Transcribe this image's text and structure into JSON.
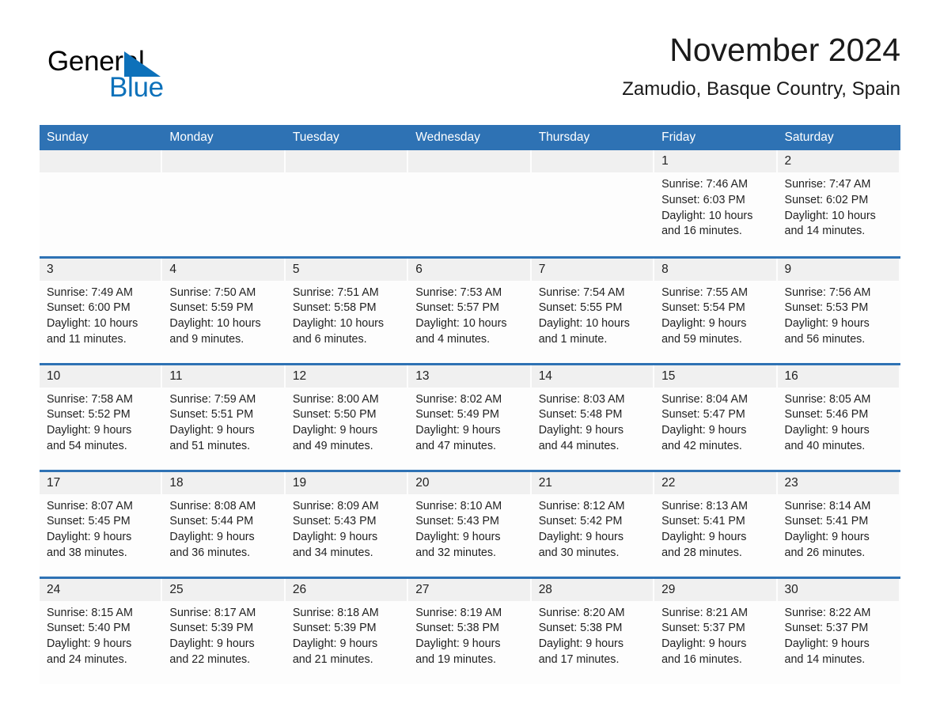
{
  "brand": {
    "name_part1": "General",
    "name_part2": "Blue",
    "flag_icon": "triangle-flag-icon",
    "colors": {
      "blue": "#0d71ba",
      "black": "#000000"
    }
  },
  "header": {
    "month_title": "November 2024",
    "location": "Zamudio, Basque Country, Spain"
  },
  "theme": {
    "header_blue": "#2e72b4",
    "daynum_bg": "#f0f0f0",
    "cell_bg": "#fdfdfd",
    "text": "#222222"
  },
  "weekday_headers": [
    "Sunday",
    "Monday",
    "Tuesday",
    "Wednesday",
    "Thursday",
    "Friday",
    "Saturday"
  ],
  "weeks": [
    [
      {
        "day": "",
        "empty": true,
        "lines": []
      },
      {
        "day": "",
        "empty": true,
        "lines": []
      },
      {
        "day": "",
        "empty": true,
        "lines": []
      },
      {
        "day": "",
        "empty": true,
        "lines": []
      },
      {
        "day": "",
        "empty": true,
        "lines": []
      },
      {
        "day": "1",
        "empty": false,
        "lines": [
          "Sunrise: 7:46 AM",
          "Sunset: 6:03 PM",
          "Daylight: 10 hours",
          "and 16 minutes."
        ]
      },
      {
        "day": "2",
        "empty": false,
        "lines": [
          "Sunrise: 7:47 AM",
          "Sunset: 6:02 PM",
          "Daylight: 10 hours",
          "and 14 minutes."
        ]
      }
    ],
    [
      {
        "day": "3",
        "empty": false,
        "lines": [
          "Sunrise: 7:49 AM",
          "Sunset: 6:00 PM",
          "Daylight: 10 hours",
          "and 11 minutes."
        ]
      },
      {
        "day": "4",
        "empty": false,
        "lines": [
          "Sunrise: 7:50 AM",
          "Sunset: 5:59 PM",
          "Daylight: 10 hours",
          "and 9 minutes."
        ]
      },
      {
        "day": "5",
        "empty": false,
        "lines": [
          "Sunrise: 7:51 AM",
          "Sunset: 5:58 PM",
          "Daylight: 10 hours",
          "and 6 minutes."
        ]
      },
      {
        "day": "6",
        "empty": false,
        "lines": [
          "Sunrise: 7:53 AM",
          "Sunset: 5:57 PM",
          "Daylight: 10 hours",
          "and 4 minutes."
        ]
      },
      {
        "day": "7",
        "empty": false,
        "lines": [
          "Sunrise: 7:54 AM",
          "Sunset: 5:55 PM",
          "Daylight: 10 hours",
          "and 1 minute."
        ]
      },
      {
        "day": "8",
        "empty": false,
        "lines": [
          "Sunrise: 7:55 AM",
          "Sunset: 5:54 PM",
          "Daylight: 9 hours",
          "and 59 minutes."
        ]
      },
      {
        "day": "9",
        "empty": false,
        "lines": [
          "Sunrise: 7:56 AM",
          "Sunset: 5:53 PM",
          "Daylight: 9 hours",
          "and 56 minutes."
        ]
      }
    ],
    [
      {
        "day": "10",
        "empty": false,
        "lines": [
          "Sunrise: 7:58 AM",
          "Sunset: 5:52 PM",
          "Daylight: 9 hours",
          "and 54 minutes."
        ]
      },
      {
        "day": "11",
        "empty": false,
        "lines": [
          "Sunrise: 7:59 AM",
          "Sunset: 5:51 PM",
          "Daylight: 9 hours",
          "and 51 minutes."
        ]
      },
      {
        "day": "12",
        "empty": false,
        "lines": [
          "Sunrise: 8:00 AM",
          "Sunset: 5:50 PM",
          "Daylight: 9 hours",
          "and 49 minutes."
        ]
      },
      {
        "day": "13",
        "empty": false,
        "lines": [
          "Sunrise: 8:02 AM",
          "Sunset: 5:49 PM",
          "Daylight: 9 hours",
          "and 47 minutes."
        ]
      },
      {
        "day": "14",
        "empty": false,
        "lines": [
          "Sunrise: 8:03 AM",
          "Sunset: 5:48 PM",
          "Daylight: 9 hours",
          "and 44 minutes."
        ]
      },
      {
        "day": "15",
        "empty": false,
        "lines": [
          "Sunrise: 8:04 AM",
          "Sunset: 5:47 PM",
          "Daylight: 9 hours",
          "and 42 minutes."
        ]
      },
      {
        "day": "16",
        "empty": false,
        "lines": [
          "Sunrise: 8:05 AM",
          "Sunset: 5:46 PM",
          "Daylight: 9 hours",
          "and 40 minutes."
        ]
      }
    ],
    [
      {
        "day": "17",
        "empty": false,
        "lines": [
          "Sunrise: 8:07 AM",
          "Sunset: 5:45 PM",
          "Daylight: 9 hours",
          "and 38 minutes."
        ]
      },
      {
        "day": "18",
        "empty": false,
        "lines": [
          "Sunrise: 8:08 AM",
          "Sunset: 5:44 PM",
          "Daylight: 9 hours",
          "and 36 minutes."
        ]
      },
      {
        "day": "19",
        "empty": false,
        "lines": [
          "Sunrise: 8:09 AM",
          "Sunset: 5:43 PM",
          "Daylight: 9 hours",
          "and 34 minutes."
        ]
      },
      {
        "day": "20",
        "empty": false,
        "lines": [
          "Sunrise: 8:10 AM",
          "Sunset: 5:43 PM",
          "Daylight: 9 hours",
          "and 32 minutes."
        ]
      },
      {
        "day": "21",
        "empty": false,
        "lines": [
          "Sunrise: 8:12 AM",
          "Sunset: 5:42 PM",
          "Daylight: 9 hours",
          "and 30 minutes."
        ]
      },
      {
        "day": "22",
        "empty": false,
        "lines": [
          "Sunrise: 8:13 AM",
          "Sunset: 5:41 PM",
          "Daylight: 9 hours",
          "and 28 minutes."
        ]
      },
      {
        "day": "23",
        "empty": false,
        "lines": [
          "Sunrise: 8:14 AM",
          "Sunset: 5:41 PM",
          "Daylight: 9 hours",
          "and 26 minutes."
        ]
      }
    ],
    [
      {
        "day": "24",
        "empty": false,
        "lines": [
          "Sunrise: 8:15 AM",
          "Sunset: 5:40 PM",
          "Daylight: 9 hours",
          "and 24 minutes."
        ]
      },
      {
        "day": "25",
        "empty": false,
        "lines": [
          "Sunrise: 8:17 AM",
          "Sunset: 5:39 PM",
          "Daylight: 9 hours",
          "and 22 minutes."
        ]
      },
      {
        "day": "26",
        "empty": false,
        "lines": [
          "Sunrise: 8:18 AM",
          "Sunset: 5:39 PM",
          "Daylight: 9 hours",
          "and 21 minutes."
        ]
      },
      {
        "day": "27",
        "empty": false,
        "lines": [
          "Sunrise: 8:19 AM",
          "Sunset: 5:38 PM",
          "Daylight: 9 hours",
          "and 19 minutes."
        ]
      },
      {
        "day": "28",
        "empty": false,
        "lines": [
          "Sunrise: 8:20 AM",
          "Sunset: 5:38 PM",
          "Daylight: 9 hours",
          "and 17 minutes."
        ]
      },
      {
        "day": "29",
        "empty": false,
        "lines": [
          "Sunrise: 8:21 AM",
          "Sunset: 5:37 PM",
          "Daylight: 9 hours",
          "and 16 minutes."
        ]
      },
      {
        "day": "30",
        "empty": false,
        "lines": [
          "Sunrise: 8:22 AM",
          "Sunset: 5:37 PM",
          "Daylight: 9 hours",
          "and 14 minutes."
        ]
      }
    ]
  ]
}
